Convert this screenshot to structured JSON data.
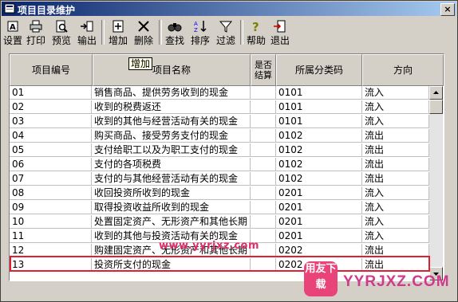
{
  "window": {
    "title": "项目目录维护",
    "close_glyph": "×"
  },
  "toolbar": {
    "buttons": [
      {
        "label": "设置",
        "icon": "settings-icon"
      },
      {
        "label": "打印",
        "icon": "print-icon"
      },
      {
        "label": "预览",
        "icon": "preview-icon"
      },
      {
        "label": "输出",
        "icon": "export-icon"
      },
      {
        "label": "增加",
        "icon": "add-icon"
      },
      {
        "label": "删除",
        "icon": "delete-icon"
      },
      {
        "label": "查找",
        "icon": "find-icon"
      },
      {
        "label": "排序",
        "icon": "sort-icon"
      },
      {
        "label": "过滤",
        "icon": "filter-icon"
      },
      {
        "label": "帮助",
        "icon": "help-icon"
      },
      {
        "label": "退出",
        "icon": "exit-icon"
      }
    ]
  },
  "tooltip": "增加",
  "table": {
    "columns": [
      "项目编号",
      "项目名称",
      "是否结算",
      "所属分类码",
      "方向"
    ],
    "rows": [
      {
        "code": "01",
        "name": "销售商品、提供劳务收到的现金",
        "settle": "",
        "category": "0101",
        "direction": "流入"
      },
      {
        "code": "02",
        "name": "收到的税费返还",
        "settle": "",
        "category": "0101",
        "direction": "流入"
      },
      {
        "code": "03",
        "name": "收到的其他与经营活动有关的现金",
        "settle": "",
        "category": "0101",
        "direction": "流入"
      },
      {
        "code": "04",
        "name": "购买商品、接受劳务支付的现金",
        "settle": "",
        "category": "0102",
        "direction": "流出"
      },
      {
        "code": "05",
        "name": "支付给职工以及为职工支付的现金",
        "settle": "",
        "category": "0102",
        "direction": "流出"
      },
      {
        "code": "06",
        "name": "支付的各项税费",
        "settle": "",
        "category": "0102",
        "direction": "流出"
      },
      {
        "code": "07",
        "name": "支付的与其他经营活动有关的现金",
        "settle": "",
        "category": "0102",
        "direction": "流出"
      },
      {
        "code": "08",
        "name": "收回投资所收到的现金",
        "settle": "",
        "category": "0201",
        "direction": "流入"
      },
      {
        "code": "09",
        "name": "取得投资收益所收到的现金",
        "settle": "",
        "category": "0201",
        "direction": "流入"
      },
      {
        "code": "10",
        "name": "处置固定资产、无形资产和其他长期",
        "settle": "",
        "category": "0201",
        "direction": "流入"
      },
      {
        "code": "11",
        "name": "收到的其他与投资活动有关的现金",
        "settle": "",
        "category": "0201",
        "direction": "流入"
      },
      {
        "code": "12",
        "name": "购建固定资产、无形资产和其他长期",
        "settle": "",
        "category": "0202",
        "direction": "流出"
      },
      {
        "code": "13",
        "name": "投资所支付的现金",
        "settle": "",
        "category": "0202",
        "direction": "流出"
      }
    ]
  },
  "watermarks": {
    "site": "www.yyrjxz.com",
    "logo_text": "用友下载",
    "brand": "YYRJXZ.COM"
  }
}
